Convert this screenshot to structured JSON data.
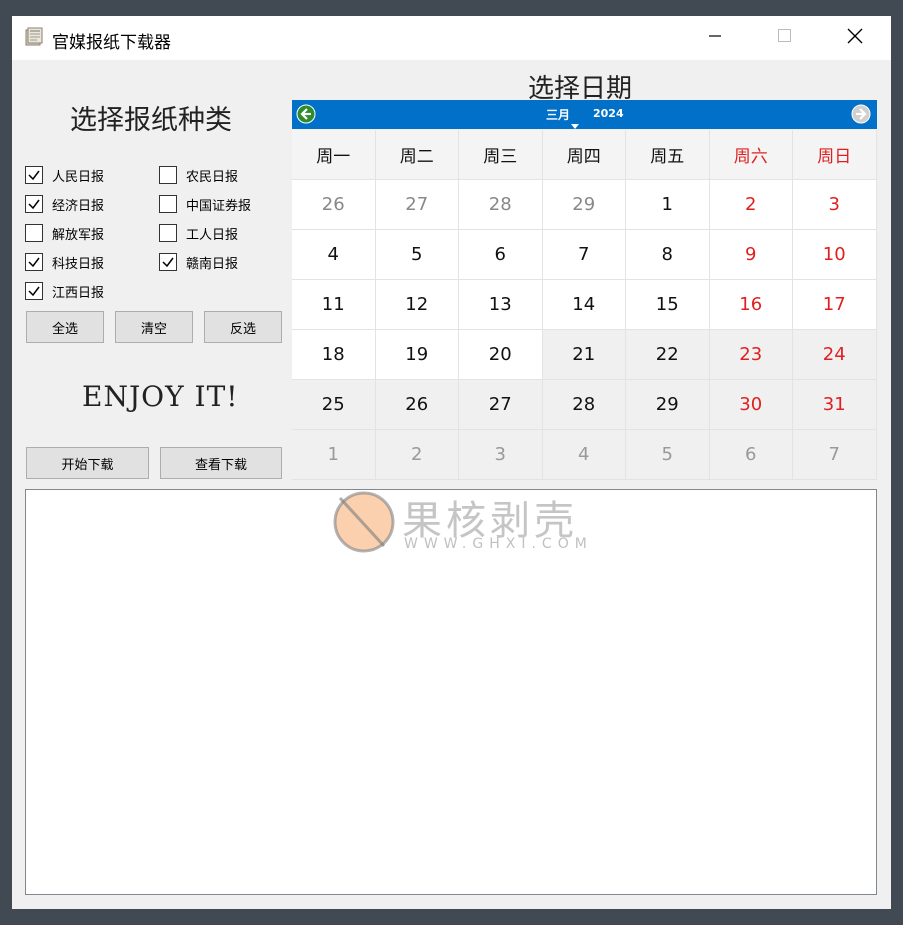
{
  "window": {
    "title": "官媒报纸下载器",
    "icon": "newspaper-icon",
    "controls": [
      "minimize-icon",
      "maximize-icon",
      "close-icon"
    ]
  },
  "left_panel": {
    "heading": "选择报纸种类",
    "checkboxes": [
      {
        "label": "人民日报",
        "checked": true
      },
      {
        "label": "农民日报",
        "checked": false
      },
      {
        "label": "经济日报",
        "checked": true
      },
      {
        "label": "中国证券报",
        "checked": false
      },
      {
        "label": "解放军报",
        "checked": false
      },
      {
        "label": "工人日报",
        "checked": false
      },
      {
        "label": "科技日报",
        "checked": true
      },
      {
        "label": "赣南日报",
        "checked": true
      },
      {
        "label": "江西日报",
        "checked": true
      }
    ],
    "buttons": {
      "select_all": "全选",
      "clear": "清空",
      "invert": "反选"
    },
    "enjoy": "ENJOY IT!",
    "actions": {
      "start": "开始下载",
      "view": "查看下载"
    }
  },
  "calendar": {
    "heading": "选择日期",
    "month": "三月",
    "year": "2024",
    "weekdays": [
      "周一",
      "周二",
      "周三",
      "周四",
      "周五",
      "周六",
      "周日"
    ],
    "weeks": [
      [
        "26",
        "27",
        "28",
        "29",
        "1",
        "2",
        "3"
      ],
      [
        "4",
        "5",
        "6",
        "7",
        "8",
        "9",
        "10"
      ],
      [
        "11",
        "12",
        "13",
        "14",
        "15",
        "16",
        "17"
      ],
      [
        "18",
        "19",
        "20",
        "21",
        "22",
        "23",
        "24"
      ],
      [
        "25",
        "26",
        "27",
        "28",
        "29",
        "30",
        "31"
      ],
      [
        "1",
        "2",
        "3",
        "4",
        "5",
        "6",
        "7"
      ]
    ],
    "colors": {
      "header": "#0070c8",
      "weekend": "#e02020",
      "nav_prev": "#2e8b2e"
    }
  },
  "log": {
    "text": ""
  },
  "watermark": {
    "text": "果核剥壳",
    "url": "WWW.GHXI.COM"
  }
}
